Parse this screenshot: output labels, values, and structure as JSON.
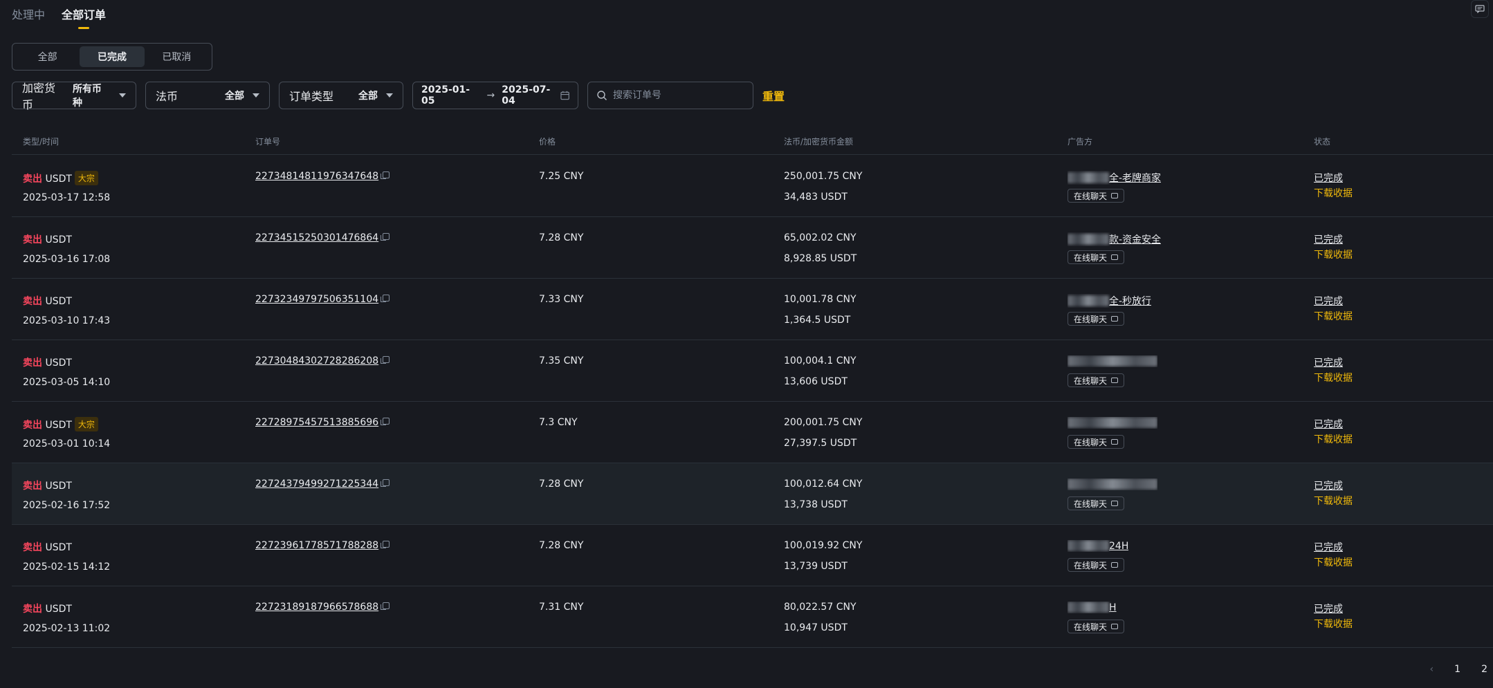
{
  "top_tabs": [
    {
      "label": "处理中",
      "active": false
    },
    {
      "label": "全部订单",
      "active": true
    }
  ],
  "status_segments": [
    {
      "label": "全部",
      "active": false
    },
    {
      "label": "已完成",
      "active": true
    },
    {
      "label": "已取消",
      "active": false
    }
  ],
  "filters": {
    "crypto": {
      "label": "加密货币",
      "value": "所有币种"
    },
    "fiat": {
      "label": "法币",
      "value": "全部"
    },
    "order_type": {
      "label": "订单类型",
      "value": "全部"
    },
    "date_from": "2025-01-05",
    "date_to": "2025-07-04",
    "search_placeholder": "搜索订单号",
    "reset_label": "重置"
  },
  "table": {
    "headers": {
      "type_time": "类型/时间",
      "order_no": "订单号",
      "price": "价格",
      "amount": "法币/加密货币金额",
      "advertiser": "广告方",
      "status": "状态"
    },
    "chat_label": "在线聊天",
    "download_label": "下载收据",
    "rows": [
      {
        "side": "卖出",
        "asset": "USDT",
        "bulk": "大宗",
        "time": "2025-03-17 12:58",
        "order_no": "22734814811976347648",
        "price": "7.25 CNY",
        "fiat_amount": "250,001.75 CNY",
        "crypto_amount": "34,483 USDT",
        "advertiser_suffix": "全-老牌商家",
        "status": "已完成"
      },
      {
        "side": "卖出",
        "asset": "USDT",
        "bulk": "",
        "time": "2025-03-16 17:08",
        "order_no": "22734515250301476864",
        "price": "7.28 CNY",
        "fiat_amount": "65,002.02 CNY",
        "crypto_amount": "8,928.85 USDT",
        "advertiser_suffix": "款-资金安全",
        "status": "已完成"
      },
      {
        "side": "卖出",
        "asset": "USDT",
        "bulk": "",
        "time": "2025-03-10 17:43",
        "order_no": "22732349797506351104",
        "price": "7.33 CNY",
        "fiat_amount": "10,001.78 CNY",
        "crypto_amount": "1,364.5 USDT",
        "advertiser_suffix": "全-秒放行",
        "status": "已完成"
      },
      {
        "side": "卖出",
        "asset": "USDT",
        "bulk": "",
        "time": "2025-03-05 14:10",
        "order_no": "22730484302728286208",
        "price": "7.35 CNY",
        "fiat_amount": "100,004.1 CNY",
        "crypto_amount": "13,606 USDT",
        "advertiser_suffix": "",
        "status": "已完成"
      },
      {
        "side": "卖出",
        "asset": "USDT",
        "bulk": "大宗",
        "time": "2025-03-01 10:14",
        "order_no": "22728975457513885696",
        "price": "7.3 CNY",
        "fiat_amount": "200,001.75 CNY",
        "crypto_amount": "27,397.5 USDT",
        "advertiser_suffix": "",
        "status": "已完成"
      },
      {
        "side": "卖出",
        "asset": "USDT",
        "bulk": "",
        "time": "2025-02-16 17:52",
        "order_no": "22724379499271225344",
        "price": "7.28 CNY",
        "fiat_amount": "100,012.64 CNY",
        "crypto_amount": "13,738 USDT",
        "advertiser_suffix": "",
        "status": "已完成"
      },
      {
        "side": "卖出",
        "asset": "USDT",
        "bulk": "",
        "time": "2025-02-15 14:12",
        "order_no": "22723961778571788288",
        "price": "7.28 CNY",
        "fiat_amount": "100,019.92 CNY",
        "crypto_amount": "13,739 USDT",
        "advertiser_suffix": "24H",
        "status": "已完成"
      },
      {
        "side": "卖出",
        "asset": "USDT",
        "bulk": "",
        "time": "2025-02-13 11:02",
        "order_no": "22723189187966578688",
        "price": "7.31 CNY",
        "fiat_amount": "80,022.57 CNY",
        "crypto_amount": "10,947 USDT",
        "advertiser_suffix": "H",
        "status": "已完成"
      }
    ]
  },
  "pagination": {
    "pages": [
      "1",
      "2"
    ],
    "current": "1"
  },
  "colors": {
    "accent": "#f0b90b",
    "sell": "#f6465d",
    "background": "#181a20"
  }
}
